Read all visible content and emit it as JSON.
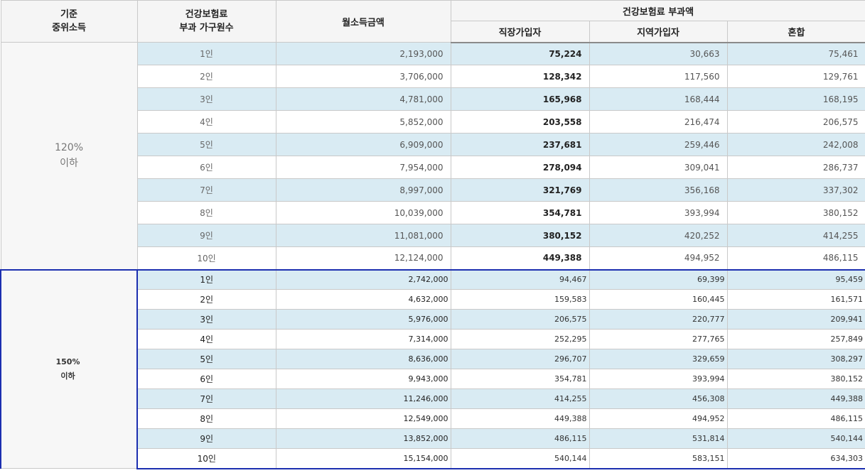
{
  "header": {
    "col1": "기준\n중위소득",
    "col2": "건강보험료\n부과 가구원수",
    "col3": "월소득금액",
    "group": "건강보험료 부과액",
    "sub1": "직장가입자",
    "sub2": "지역가입자",
    "sub3": "혼합"
  },
  "section1": {
    "label": "120%\n이하",
    "rows": [
      {
        "people": "1인",
        "income": "2,193,000",
        "employee": "75,224",
        "regional": "30,663",
        "mixed": "75,461"
      },
      {
        "people": "2인",
        "income": "3,706,000",
        "employee": "128,342",
        "regional": "117,560",
        "mixed": "129,761"
      },
      {
        "people": "3인",
        "income": "4,781,000",
        "employee": "165,968",
        "regional": "168,444",
        "mixed": "168,195"
      },
      {
        "people": "4인",
        "income": "5,852,000",
        "employee": "203,558",
        "regional": "216,474",
        "mixed": "206,575"
      },
      {
        "people": "5인",
        "income": "6,909,000",
        "employee": "237,681",
        "regional": "259,446",
        "mixed": "242,008"
      },
      {
        "people": "6인",
        "income": "7,954,000",
        "employee": "278,094",
        "regional": "309,041",
        "mixed": "286,737"
      },
      {
        "people": "7인",
        "income": "8,997,000",
        "employee": "321,769",
        "regional": "356,168",
        "mixed": "337,302"
      },
      {
        "people": "8인",
        "income": "10,039,000",
        "employee": "354,781",
        "regional": "393,994",
        "mixed": "380,152"
      },
      {
        "people": "9인",
        "income": "11,081,000",
        "employee": "380,152",
        "regional": "420,252",
        "mixed": "414,255"
      },
      {
        "people": "10인",
        "income": "12,124,000",
        "employee": "449,388",
        "regional": "494,952",
        "mixed": "486,115"
      }
    ]
  },
  "section2": {
    "label": "150%\n이하",
    "rows": [
      {
        "people": "1인",
        "income": "2,742,000",
        "employee": "94,467",
        "regional": "69,399",
        "mixed": "95,459"
      },
      {
        "people": "2인",
        "income": "4,632,000",
        "employee": "159,583",
        "regional": "160,445",
        "mixed": "161,571"
      },
      {
        "people": "3인",
        "income": "5,976,000",
        "employee": "206,575",
        "regional": "220,777",
        "mixed": "209,941"
      },
      {
        "people": "4인",
        "income": "7,314,000",
        "employee": "252,295",
        "regional": "277,765",
        "mixed": "257,849"
      },
      {
        "people": "5인",
        "income": "8,636,000",
        "employee": "296,707",
        "regional": "329,659",
        "mixed": "308,297"
      },
      {
        "people": "6인",
        "income": "9,943,000",
        "employee": "354,781",
        "regional": "393,994",
        "mixed": "380,152"
      },
      {
        "people": "7인",
        "income": "11,246,000",
        "employee": "414,255",
        "regional": "456,308",
        "mixed": "449,388"
      },
      {
        "people": "8인",
        "income": "12,549,000",
        "employee": "449,388",
        "regional": "494,952",
        "mixed": "486,115"
      },
      {
        "people": "9인",
        "income": "13,852,000",
        "employee": "486,115",
        "regional": "531,814",
        "mixed": "540,144"
      },
      {
        "people": "10인",
        "income": "15,154,000",
        "employee": "540,144",
        "regional": "583,151",
        "mixed": "634,303"
      }
    ]
  }
}
